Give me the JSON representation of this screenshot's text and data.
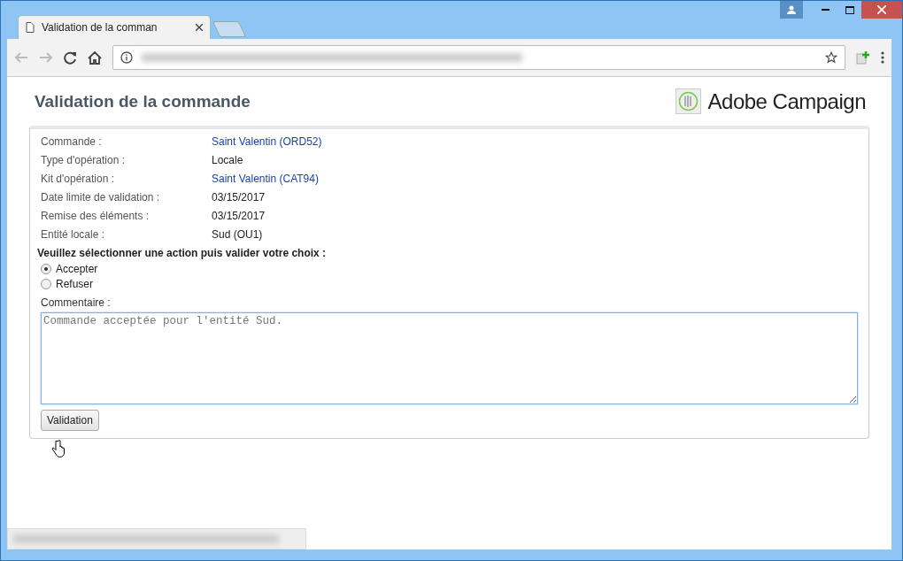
{
  "browser": {
    "tab_title": "Validation de la comman"
  },
  "page": {
    "title": "Validation de la commande",
    "brand": "Adobe Campaign"
  },
  "fields": [
    {
      "label": "Commande :",
      "value": "Saint Valentin (ORD52)",
      "kind": "link"
    },
    {
      "label": "Type d'opération :",
      "value": "Locale",
      "kind": "text"
    },
    {
      "label": "Kit d'opération :",
      "value": "Saint Valentin (CAT94)",
      "kind": "link"
    },
    {
      "label": "Date limite de validation :",
      "value": "03/15/2017",
      "kind": "text"
    },
    {
      "label": "Remise des éléments :",
      "value": "03/15/2017",
      "kind": "text"
    },
    {
      "label": "Entité locale :",
      "value": "Sud (OU1)",
      "kind": "text"
    }
  ],
  "prompt": "Veuillez sélectionner une action puis valider votre choix :",
  "actions": [
    {
      "label": "Accepter",
      "selected": true
    },
    {
      "label": "Refuser",
      "selected": false
    }
  ],
  "comment": {
    "label": "Commentaire :",
    "placeholder": "Commande acceptée pour l'entité Sud."
  },
  "submit": "Validation"
}
